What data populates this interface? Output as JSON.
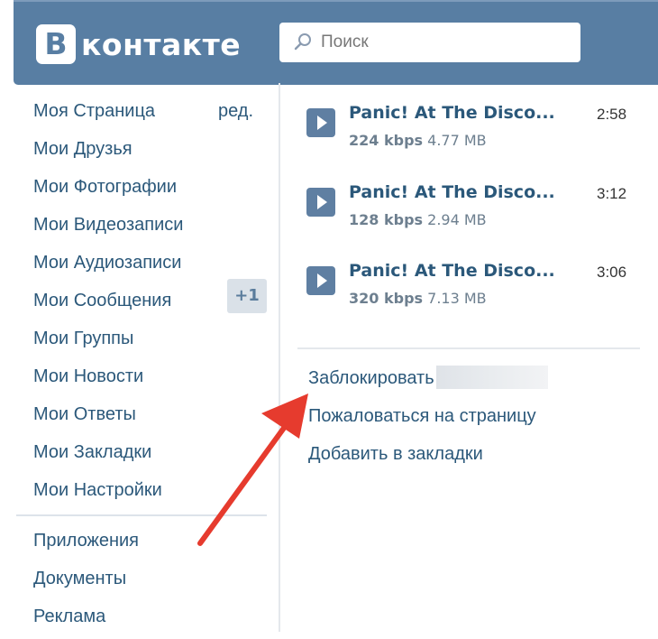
{
  "header": {
    "logo_letter": "В",
    "logo_text": "контакте",
    "search_placeholder": "Поиск"
  },
  "sidebar": {
    "items": [
      {
        "label": "Моя Страница"
      },
      {
        "label": "Мои Друзья"
      },
      {
        "label": "Мои Фотографии"
      },
      {
        "label": "Мои Видеозаписи"
      },
      {
        "label": "Мои Аудиозаписи"
      },
      {
        "label": "Мои Сообщения"
      },
      {
        "label": "Мои Группы"
      },
      {
        "label": "Мои Новости"
      },
      {
        "label": "Мои Ответы"
      },
      {
        "label": "Мои Закладки"
      },
      {
        "label": "Мои Настройки"
      }
    ],
    "edit_label": "ред.",
    "messages_badge": "+1",
    "extra_items": [
      {
        "label": "Приложения"
      },
      {
        "label": "Документы"
      },
      {
        "label": "Реклама"
      }
    ]
  },
  "audio": {
    "tracks": [
      {
        "title": "Panic! At The Disco...",
        "bitrate": "224 kbps",
        "size": "4.77 MB",
        "duration": "2:58"
      },
      {
        "title": "Panic! At The Disco...",
        "bitrate": "128 kbps",
        "size": "2.94 MB",
        "duration": "3:12"
      },
      {
        "title": "Panic! At The Disco...",
        "bitrate": "320 kbps",
        "size": "7.13 MB",
        "duration": "3:06"
      }
    ]
  },
  "actions": {
    "block": "Заблокировать",
    "report": "Пожаловаться на страницу",
    "bookmark": "Добавить в закладки"
  },
  "colors": {
    "header": "#587ea3",
    "link": "#2b587a",
    "annotation_arrow": "#e63b2e"
  }
}
